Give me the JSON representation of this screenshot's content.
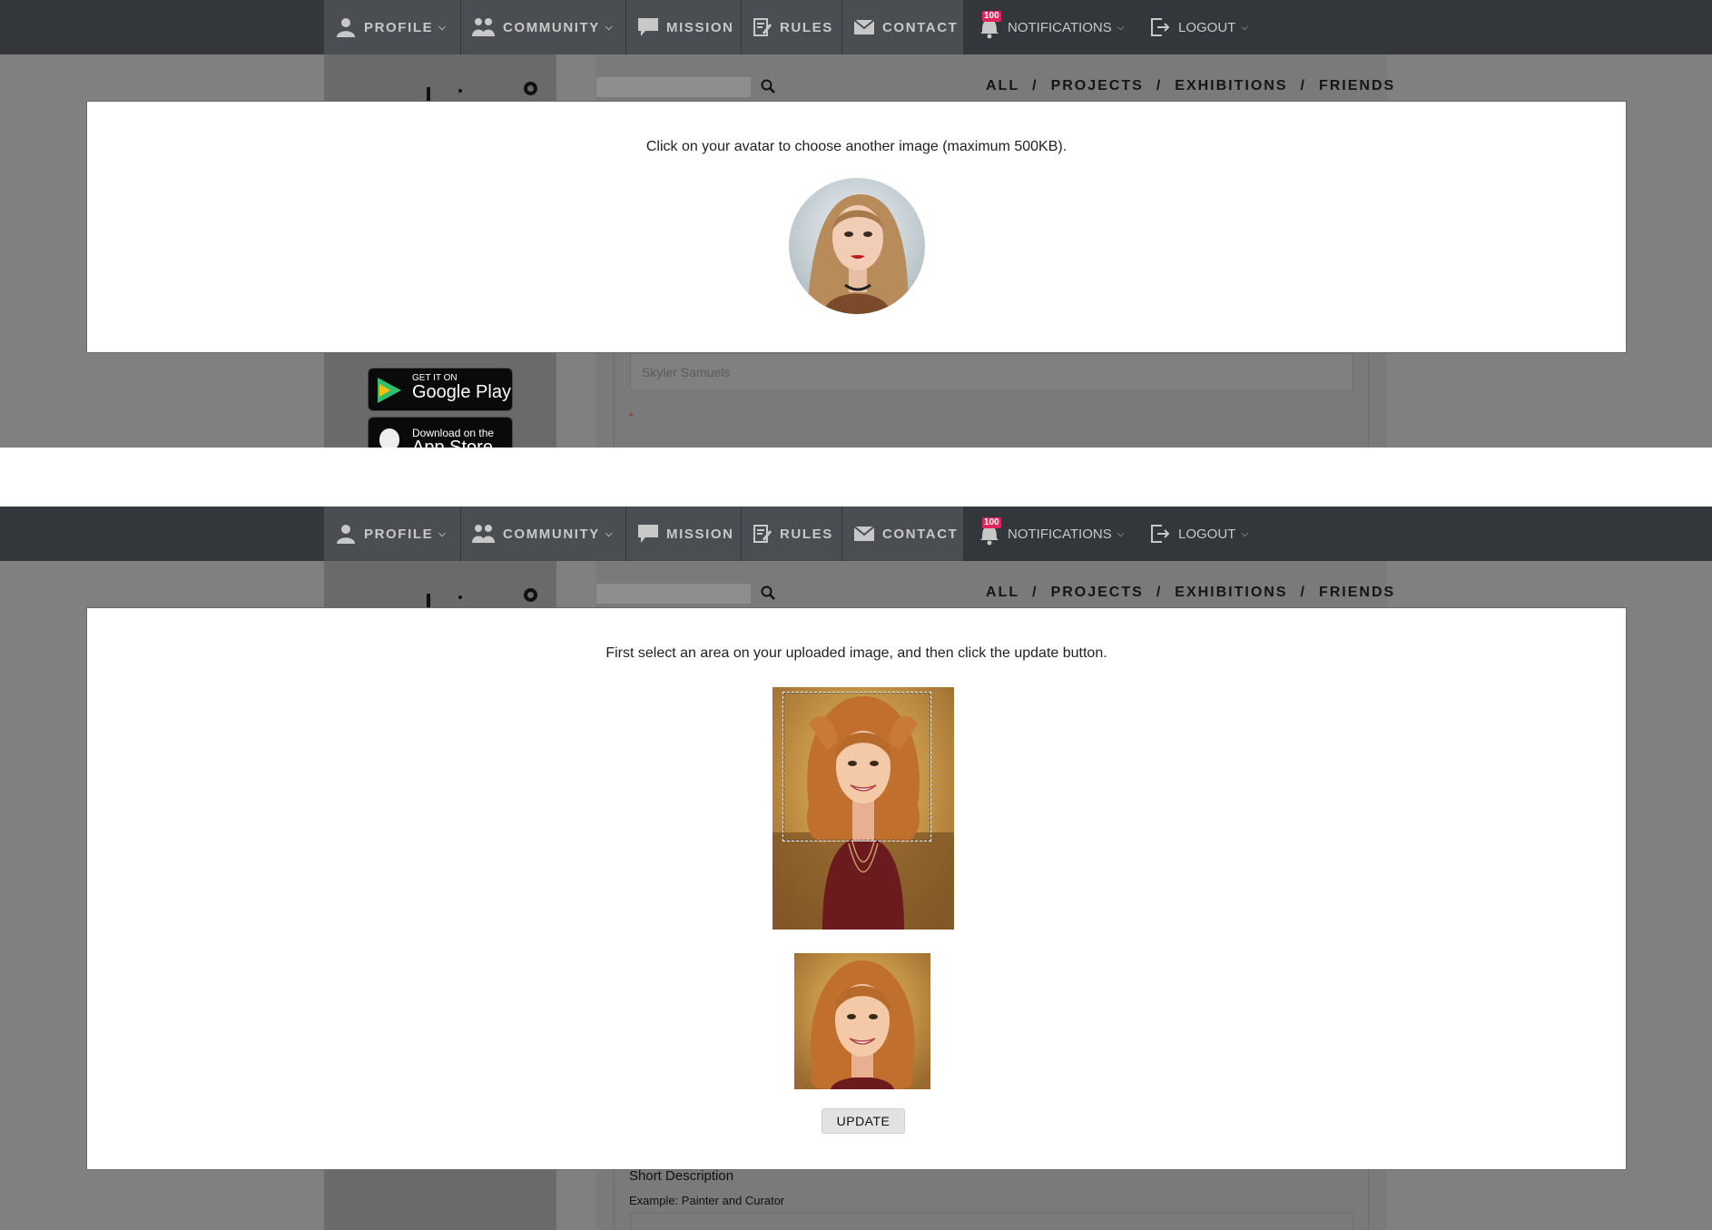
{
  "nav": {
    "profile": "PROFILE",
    "community": "COMMUNITY",
    "mission": "MISSION",
    "rules": "RULES",
    "contact": "CONTACT",
    "notifications": "NOTIFICATIONS",
    "notifications_badge": "100",
    "logout": "LOGOUT"
  },
  "filters": {
    "all": "ALL",
    "projects": "PROJECTS",
    "exhibitions": "EXHIBITIONS",
    "friends": "FRIENDS",
    "separator": "/"
  },
  "page": {
    "name_value": "Skyler Samuels",
    "required_mark": "*",
    "google_play_small": "GET IT ON",
    "google_play_big": "Google Play",
    "app_store_small": "Download on the",
    "app_store_big": "App Store",
    "short_description_label": "Short Description",
    "short_description_example": "Example: Painter and Curator"
  },
  "modal_avatar": {
    "instruction": "Click on your avatar to choose another image (maximum 500KB)."
  },
  "modal_crop": {
    "instruction": "First select an area on your uploaded image, and then click the update button.",
    "update_label": "UPDATE"
  },
  "colors": {
    "nav_bg": "#33363b",
    "nav_item_bg": "#4a4d52",
    "overlay": "#808080",
    "badge": "#e0245e"
  },
  "icons": [
    "user-icon",
    "community-icon",
    "chat-bubble-icon",
    "rules-icon",
    "envelope-icon",
    "bell-icon",
    "logout-icon",
    "search-icon",
    "chevron-down-icon"
  ]
}
